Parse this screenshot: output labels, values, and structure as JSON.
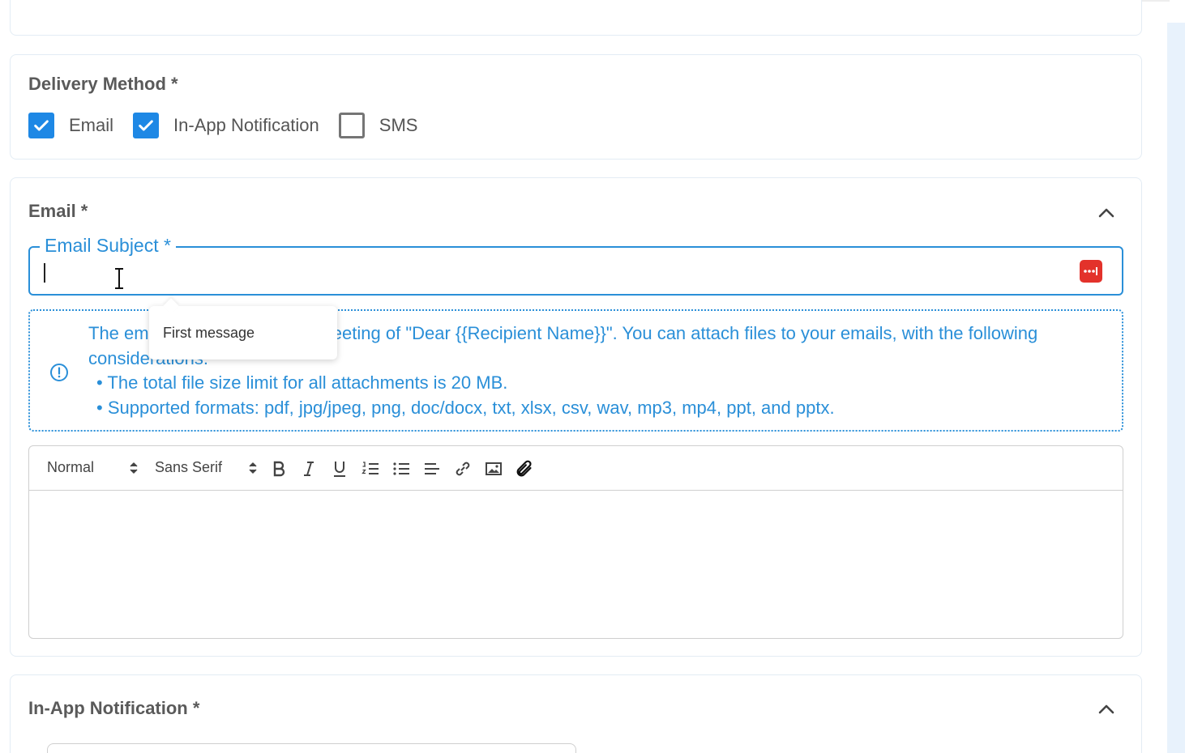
{
  "delivery": {
    "title": "Delivery Method *",
    "options": [
      {
        "label": "Email",
        "checked": true
      },
      {
        "label": "In-App Notification",
        "checked": true
      },
      {
        "label": "SMS",
        "checked": false
      }
    ]
  },
  "email": {
    "title": "Email *",
    "subject_label": "Email Subject *",
    "subject_value": "",
    "tooltip": "First message",
    "info": {
      "line1": "The email will begin with the greeting of \"Dear {{Recipient Name}}\". You can attach files to your emails, with the following considerations:",
      "bullet1": "• The total file size limit for all attachments is 20 MB.",
      "bullet2": "• Supported formats: pdf, jpg/jpeg, png, doc/docx, txt, xlsx, csv, wav, mp3, mp4, ppt, and pptx."
    },
    "toolbar": {
      "size_value": "Normal",
      "font_value": "Sans Serif"
    }
  },
  "inapp": {
    "title": "In-App Notification *"
  },
  "colors": {
    "accent": "#2a8fd8",
    "checkbox": "#1e88e5",
    "variable_button": "#e3322b"
  }
}
